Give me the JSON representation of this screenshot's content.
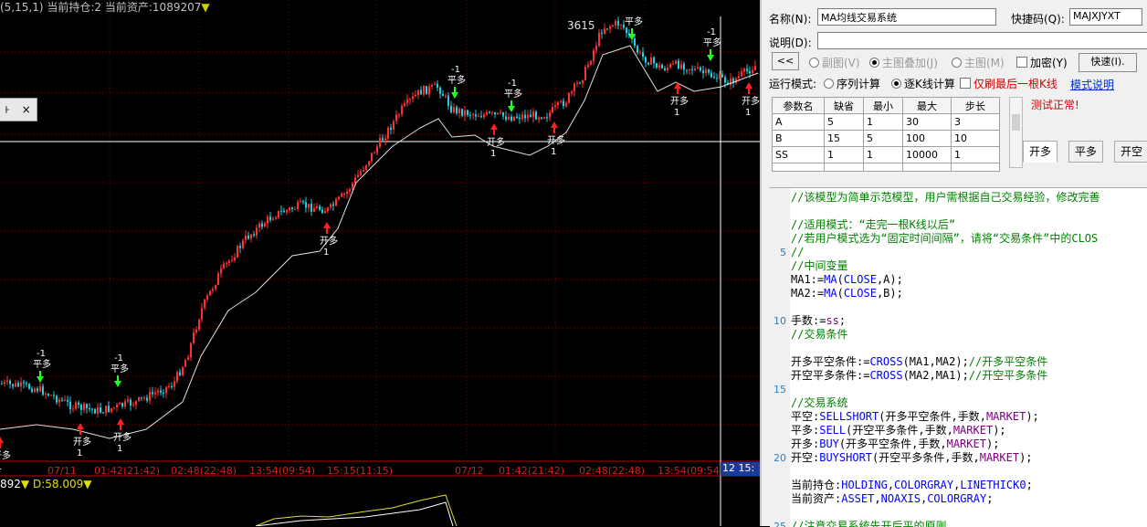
{
  "chart": {
    "header_params": "(5,15,1)",
    "header_holding": "当前持仓:2",
    "header_asset": "当前资产:1089207",
    "header_arrow": "▼",
    "peak_value": "3615",
    "sub_header_value": "892",
    "sub_header_arrow": "▼",
    "sub_header_d": "D:58.009",
    "time_labels": [
      "07/11",
      "01:42(21:42)",
      "02:48(22:48)",
      "13:54(09:54)",
      "15:15(11:15)",
      "07/12",
      "01:42(21:42)",
      "02:48(22:48)",
      "13:54(09:54)"
    ],
    "current_time_label": "12 15:",
    "float_box_pin": "꜔",
    "float_box_close": "×",
    "signals": [
      {
        "type": "flat",
        "label": "平多",
        "qty": "-1"
      },
      {
        "type": "flat",
        "label": "平多",
        "qty": "-1"
      },
      {
        "type": "open",
        "label": "开多",
        "qty": "1"
      },
      {
        "type": "open",
        "label": "开多",
        "qty": "1"
      },
      {
        "type": "open",
        "label": "开多",
        "qty": "1"
      },
      {
        "type": "flat",
        "label": "平多",
        "qty": "-1"
      },
      {
        "type": "flat",
        "label": "平多",
        "qty": "-1"
      },
      {
        "type": "open",
        "label": "开多",
        "qty": "1"
      },
      {
        "type": "open",
        "label": "开多",
        "qty": "1"
      },
      {
        "type": "flat",
        "label": "平多",
        "qty": ""
      },
      {
        "type": "open",
        "label": "开多",
        "qty": "1"
      },
      {
        "type": "flat",
        "label": "平多",
        "qty": "-1"
      },
      {
        "type": "open",
        "label": "开多",
        "qty": "1"
      },
      {
        "type": "open",
        "label": "开多",
        "qty": "1"
      }
    ],
    "colors": {
      "up": "#ff3030",
      "down": "#20d0e0",
      "ma": "#e0e0e0",
      "grid": "#7a0000",
      "sub_line": "#e0e020"
    }
  },
  "panel": {
    "name_label": "名称(N):",
    "name_value": "MA均线交易系统",
    "shortcut_label": "快捷码(Q):",
    "shortcut_value": "MAJXJYXT",
    "desc_label": "说明(D):",
    "desc_value": "",
    "back_button": "<<",
    "radio_subchart": "副图(V)",
    "radio_overlay": "主图叠加(J)",
    "radio_main": "主图(M)",
    "encrypt_label": "加密(Y)",
    "fast_button": "快速(I).",
    "run_mode_label": "运行模式:",
    "run_seq": "序列计算",
    "run_bar": "逐K线计算",
    "last_bar_only": "仅刷最后一根K线",
    "mode_help": "模式说明",
    "test_status": "测试正常!",
    "param_headers": [
      "参数名",
      "缺省",
      "最小",
      "最大",
      "步长"
    ],
    "params": [
      [
        "A",
        "5",
        "1",
        "30",
        "3"
      ],
      [
        "B",
        "15",
        "5",
        "100",
        "10"
      ],
      [
        "SS",
        "1",
        "1",
        "10000",
        "1"
      ]
    ],
    "tabs": [
      "开多",
      "平多",
      "开空"
    ]
  },
  "editor": {
    "lines": [
      {
        "n": "",
        "parts": [
          [
            "c-com",
            "//该模型为简单示范模型，用户需根据自己交易经验，修改完善"
          ]
        ]
      },
      {
        "n": "",
        "parts": []
      },
      {
        "n": "",
        "parts": [
          [
            "c-com",
            "//适用模式：“走完一根K线以后”"
          ]
        ]
      },
      {
        "n": "",
        "parts": [
          [
            "c-com",
            "//若用户模式选为“固定时间间隔”，请将“交易条件”中的CLOS"
          ]
        ]
      },
      {
        "n": "5",
        "parts": [
          [
            "c-com",
            "//"
          ]
        ]
      },
      {
        "n": "",
        "parts": [
          [
            "c-com",
            "//中间变量"
          ]
        ]
      },
      {
        "n": "",
        "parts": [
          [
            "c-txt",
            "MA1:="
          ],
          [
            "c-fn",
            "MA"
          ],
          [
            "c-txt",
            "("
          ],
          [
            "c-fn",
            "CLOSE"
          ],
          [
            "c-txt",
            ",A);"
          ]
        ]
      },
      {
        "n": "",
        "parts": [
          [
            "c-txt",
            "MA2:="
          ],
          [
            "c-fn",
            "MA"
          ],
          [
            "c-txt",
            "("
          ],
          [
            "c-fn",
            "CLOSE"
          ],
          [
            "c-txt",
            ",B);"
          ]
        ]
      },
      {
        "n": "",
        "parts": []
      },
      {
        "n": "10",
        "parts": [
          [
            "c-txt",
            "手数:="
          ],
          [
            "c-kw",
            "ss"
          ],
          [
            "c-txt",
            ";"
          ]
        ]
      },
      {
        "n": "",
        "parts": [
          [
            "c-com",
            "//交易条件"
          ]
        ]
      },
      {
        "n": "",
        "parts": []
      },
      {
        "n": "",
        "parts": [
          [
            "c-txt",
            "开多平空条件:="
          ],
          [
            "c-fn",
            "CROSS"
          ],
          [
            "c-txt",
            "(MA1,MA2);"
          ],
          [
            "c-com",
            "//开多平空条件"
          ]
        ]
      },
      {
        "n": "",
        "parts": [
          [
            "c-txt",
            "开空平多条件:="
          ],
          [
            "c-fn",
            "CROSS"
          ],
          [
            "c-txt",
            "(MA2,MA1);"
          ],
          [
            "c-com",
            "//开空平多条件"
          ]
        ]
      },
      {
        "n": "15",
        "parts": []
      },
      {
        "n": "",
        "parts": [
          [
            "c-com",
            "//交易系统"
          ]
        ]
      },
      {
        "n": "",
        "parts": [
          [
            "c-txt",
            "平空:"
          ],
          [
            "c-fn",
            "SELLSHORT"
          ],
          [
            "c-txt",
            "(开多平空条件,手数,"
          ],
          [
            "c-kw",
            "MARKET"
          ],
          [
            "c-txt",
            ");"
          ]
        ]
      },
      {
        "n": "",
        "parts": [
          [
            "c-txt",
            "平多:"
          ],
          [
            "c-fn",
            "SELL"
          ],
          [
            "c-txt",
            "(开空平多条件,手数,"
          ],
          [
            "c-kw",
            "MARKET"
          ],
          [
            "c-txt",
            ");"
          ]
        ]
      },
      {
        "n": "",
        "parts": [
          [
            "c-txt",
            "开多:"
          ],
          [
            "c-fn",
            "BUY"
          ],
          [
            "c-txt",
            "(开多平空条件,手数,"
          ],
          [
            "c-kw",
            "MARKET"
          ],
          [
            "c-txt",
            ");"
          ]
        ]
      },
      {
        "n": "20",
        "parts": [
          [
            "c-txt",
            "开空:"
          ],
          [
            "c-fn",
            "BUYSHORT"
          ],
          [
            "c-txt",
            "(开空平多条件,手数,"
          ],
          [
            "c-kw",
            "MARKET"
          ],
          [
            "c-txt",
            ");"
          ]
        ]
      },
      {
        "n": "",
        "parts": []
      },
      {
        "n": "",
        "parts": [
          [
            "c-txt",
            "当前持仓:"
          ],
          [
            "c-fn",
            "HOLDING"
          ],
          [
            "c-txt",
            ","
          ],
          [
            "c-fn",
            "COLORGRAY"
          ],
          [
            "c-txt",
            ","
          ],
          [
            "c-fn",
            "LINETHICK0"
          ],
          [
            "c-txt",
            ";"
          ]
        ]
      },
      {
        "n": "",
        "parts": [
          [
            "c-txt",
            "当前资产:"
          ],
          [
            "c-fn",
            "ASSET"
          ],
          [
            "c-txt",
            ","
          ],
          [
            "c-fn",
            "NOAXIS"
          ],
          [
            "c-txt",
            ","
          ],
          [
            "c-fn",
            "COLORGRAY"
          ],
          [
            "c-txt",
            ";"
          ]
        ]
      },
      {
        "n": "",
        "parts": []
      },
      {
        "n": "25",
        "parts": [
          [
            "c-com",
            "//注意交易系统先开后平的原则"
          ]
        ]
      }
    ]
  }
}
